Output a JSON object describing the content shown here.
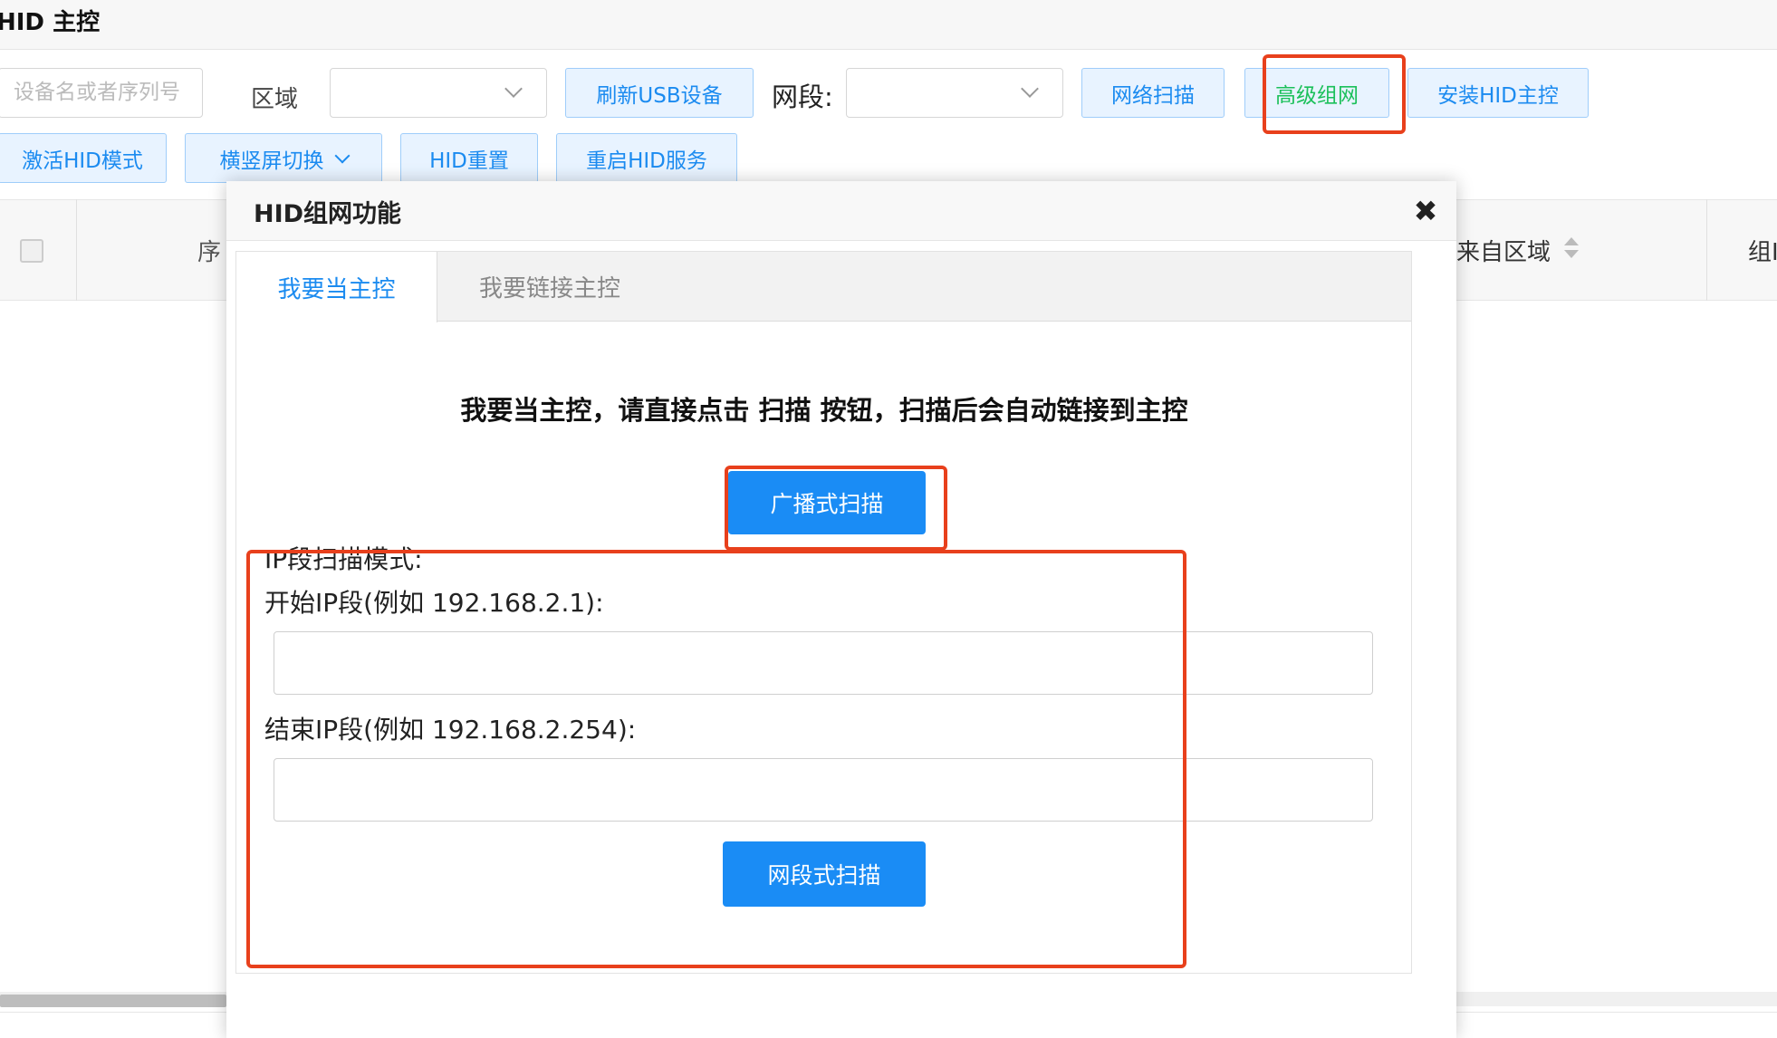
{
  "header": {
    "title": "HID 主控"
  },
  "toolbar": {
    "search_placeholder": "设备名或者序列号",
    "region_label": "区域",
    "refresh_usb_label": "刷新USB设备",
    "segment_label": "网段:",
    "network_scan_label": "网络扫描",
    "advanced_network_label": "高级组网",
    "install_hid_label": "安装HID主控",
    "activate_hid_label": "激活HID模式",
    "orientation_label": "横竖屏切换",
    "hid_reset_label": "HID重置",
    "restart_hid_label": "重启HID服务"
  },
  "table": {
    "col_index_partial": "序",
    "col_region": "来自区域",
    "col_group_partial": "组Ⅰ"
  },
  "modal": {
    "title": "HID组网功能",
    "close_icon": "✖",
    "tabs": [
      {
        "label": "我要当主控",
        "active": true
      },
      {
        "label": "我要链接主控",
        "active": false
      }
    ],
    "instruction": "我要当主控，请直接点击 扫描 按钮，扫描后会自动链接到主控",
    "broadcast_scan_label": "广播式扫描",
    "ip_scan_mode_label": "IP段扫描模式:",
    "start_ip_label": "开始IP段(例如 192.168.2.1):",
    "start_ip_value": "",
    "end_ip_label": "结束IP段(例如 192.168.2.254):",
    "end_ip_value": "",
    "segment_scan_label": "网段式扫描"
  },
  "colors": {
    "primary": "#1a8cf5",
    "highlight_red": "#e8401c",
    "green_text": "#1bc05a"
  }
}
